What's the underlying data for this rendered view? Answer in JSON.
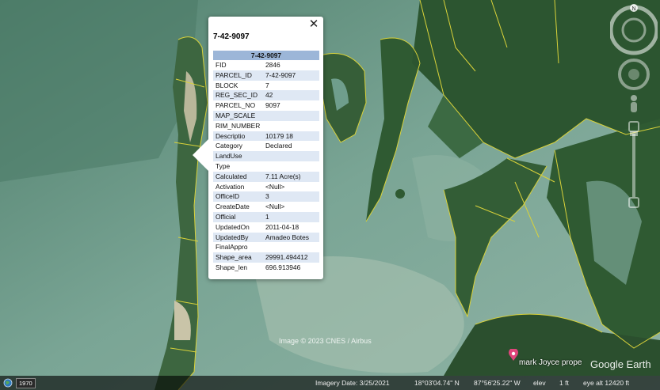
{
  "popup": {
    "title": "7-42-9097",
    "table_header": "7-42-9097",
    "close_glyph": "✕",
    "rows": [
      {
        "key": "FID",
        "value": "2846"
      },
      {
        "key": "PARCEL_ID",
        "value": "7-42-9097"
      },
      {
        "key": "BLOCK",
        "value": "7"
      },
      {
        "key": "REG_SEC_ID",
        "value": "42"
      },
      {
        "key": "PARCEL_NO",
        "value": "9097"
      },
      {
        "key": "MAP_SCALE",
        "value": ""
      },
      {
        "key": "RIM_NUMBER",
        "value": ""
      },
      {
        "key": "Descriptio",
        "value": "10179 18"
      },
      {
        "key": "Category",
        "value": "Declared"
      },
      {
        "key": "LandUse",
        "value": ""
      },
      {
        "key": "Type",
        "value": ""
      },
      {
        "key": "Calculated",
        "value": "7.11 Acre(s)"
      },
      {
        "key": "Activation",
        "value": "<Null>"
      },
      {
        "key": "OfficeID",
        "value": "3"
      },
      {
        "key": "CreateDate",
        "value": "<Null>"
      },
      {
        "key": "Official",
        "value": "1"
      },
      {
        "key": "UpdatedOn",
        "value": "2011-04-18"
      },
      {
        "key": "UpdatedBy",
        "value": "Amadeo Botes"
      },
      {
        "key": "FinalAppro",
        "value": ""
      },
      {
        "key": "Shape_area",
        "value": "29991.494412"
      },
      {
        "key": "Shape_len",
        "value": "696.913946"
      }
    ]
  },
  "map": {
    "credit": "Image © 2023 CNES / Airbus",
    "placemark_label": "mark Joyce prope",
    "logo": "Google Earth",
    "nav_north": "N",
    "colors": {
      "water": "#6f9e8c",
      "land": "#2f5a32",
      "parcel_line": "#d9d23a",
      "pin": "#e0457b"
    }
  },
  "status": {
    "year": "1970",
    "imagery_date": "Imagery Date: 3/25/2021",
    "latitude": "18°03'04.74\" N",
    "longitude": "87°56'25.22\" W",
    "elev_label": "elev",
    "elev_value": "1 ft",
    "eye_alt": "eye alt  12420 ft"
  },
  "icons": [
    "globe-icon",
    "close-icon",
    "placemark-pin-icon",
    "compass-icon",
    "look-joystick-icon",
    "street-view-person-icon",
    "zoom-slider-icon"
  ]
}
